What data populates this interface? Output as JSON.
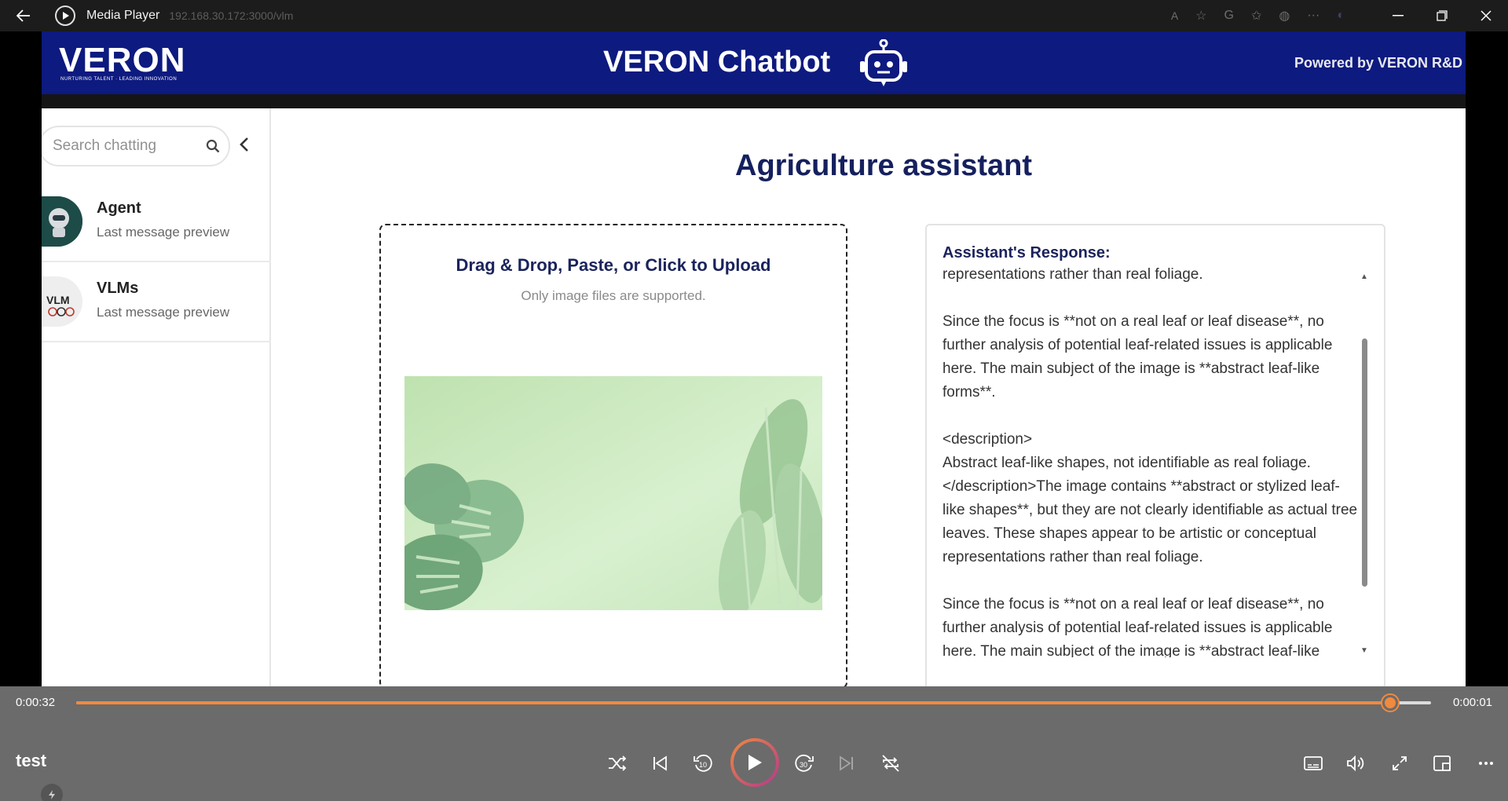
{
  "window": {
    "app_title": "Media Player",
    "url": "192.168.30.172:3000/vlm"
  },
  "header": {
    "logo_text": "VERON",
    "logo_tagline": "NURTURING TALENT · LEADING INNOVATION",
    "title": "VERON Chatbot",
    "powered_by": "Powered by VERON R&D"
  },
  "sidebar": {
    "search_placeholder": "Search chatting",
    "chats": [
      {
        "name": "Agent",
        "preview": "Last message preview"
      },
      {
        "name": "VLMs",
        "preview": "Last message preview",
        "avatar_text": "VLM"
      }
    ]
  },
  "main": {
    "title": "Agriculture assistant",
    "upload": {
      "title": "Drag & Drop, Paste, or Click to Upload",
      "note": "Only image files are supported."
    },
    "response": {
      "title": "Assistant's Response:",
      "body": "representations rather than real foliage.\n\nSince the focus is **not on a real leaf or leaf disease**, no further analysis of potential leaf-related issues is applicable here. The main subject of the image is **abstract leaf-like forms**.\n\n<description>\nAbstract leaf-like shapes, not identifiable as real foliage.\n</description>The image contains **abstract or stylized leaf-like shapes**, but they are not clearly identifiable as actual tree leaves. These shapes appear to be artistic or conceptual representations rather than real foliage.\n\nSince the focus is **not on a real leaf or leaf disease**, no further analysis of potential leaf-related issues is applicable here. The main subject of the image is **abstract leaf-like"
    }
  },
  "player": {
    "elapsed": "0:00:32",
    "remaining": "0:00:01",
    "progress": 0.97,
    "media_title": "test",
    "accent_color": "#f08a3e"
  }
}
